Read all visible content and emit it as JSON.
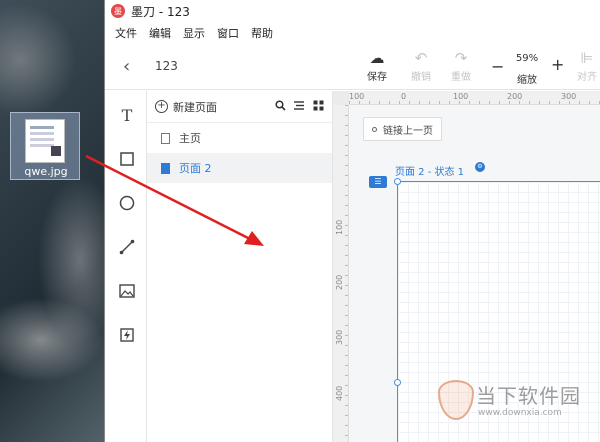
{
  "desktop": {
    "icon_label": "qwe.jpg"
  },
  "window": {
    "title": "墨刀 - 123",
    "logo_text": "墨",
    "menu": [
      "文件",
      "编辑",
      "显示",
      "窗口",
      "帮助"
    ]
  },
  "toolbar": {
    "doc_name": "123",
    "save_label": "保存",
    "undo_label": "撤销",
    "redo_label": "重做",
    "zoom_value": "59%",
    "zoom_label": "缩放",
    "align_label": "对齐"
  },
  "pages_panel": {
    "new_page_label": "新建页面",
    "pages": [
      {
        "label": "主页",
        "active": false
      },
      {
        "label": "页面 2",
        "active": true
      }
    ]
  },
  "canvas": {
    "ruler_top_ticks": [
      "100",
      "0",
      "100",
      "200",
      "300"
    ],
    "ruler_left_ticks": [
      "100",
      "200",
      "300",
      "400"
    ],
    "link_button_label": "链接上一页",
    "state_label": "页面 2 - 状态 1"
  },
  "watermark": {
    "text": "当下软件园",
    "url": "www.downxia.com"
  },
  "colors": {
    "accent": "#2d7bd5",
    "arrow": "#e02020"
  }
}
